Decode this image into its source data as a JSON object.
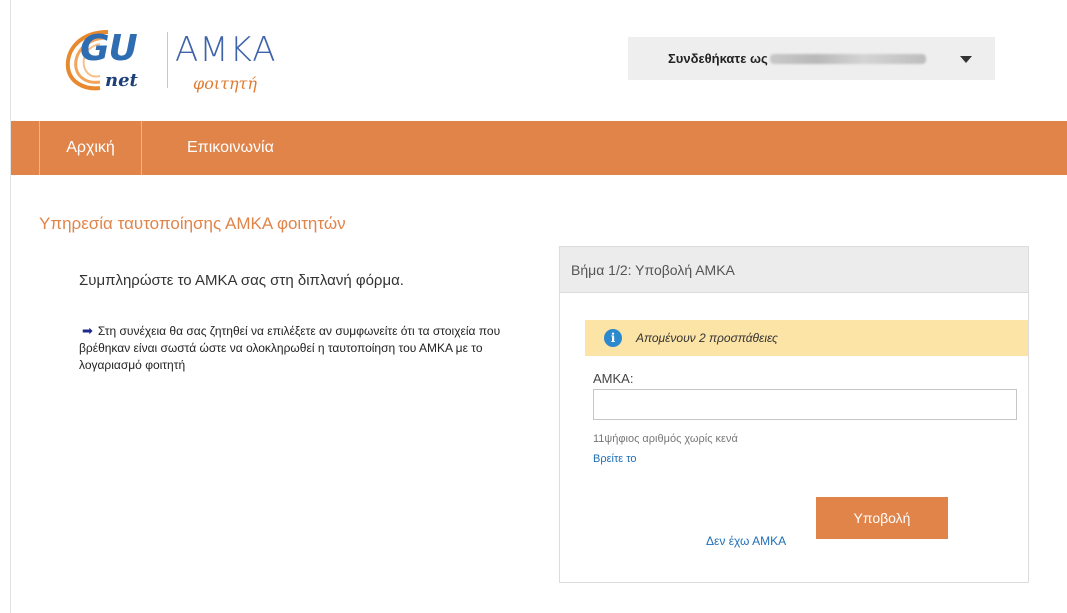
{
  "header": {
    "logo": {
      "gu_text": "GU",
      "net_text": "net",
      "amka_text": "AMKA",
      "subtitle": "φοιτητή"
    },
    "user_menu": {
      "label": "Συνδεθήκατε ως",
      "username_masked": true,
      "caret_icon": "caret-down-icon"
    }
  },
  "nav": {
    "tabs": [
      {
        "label": "Αρχική",
        "active": true
      },
      {
        "label": "Επικοινωνία",
        "active": false
      }
    ]
  },
  "main": {
    "page_title": "Υπηρεσία ταυτοποίησης ΑΜΚΑ φοιτητών",
    "intro": "Συμπληρώστε το ΑΜΚΑ σας στη διπλανή φόρμα.",
    "note": "Στη συνέχεια θα σας ζητηθεί να επιλέξετε αν συμφωνείτε ότι τα στοιχεία που βρέθηκαν είναι σωστά ώστε να ολοκληρωθεί η ταυτοποίηση του ΑΜΚΑ με το λογαριασμό φοιτητή",
    "note_icon": "arrow-right-icon"
  },
  "panel": {
    "title": "Βήμα 1/2: Υποβολή ΑΜΚΑ",
    "alert": {
      "icon": "info-icon",
      "message": "Απομένουν 2 προσπάθειες"
    },
    "field": {
      "label": "ΑΜΚΑ:",
      "value": "",
      "placeholder": ""
    },
    "hint": "11ψήφιος αριθμός χωρίς κενά",
    "find_link": "Βρείτε το",
    "no_amka_link": "Δεν έχω ΑΜΚΑ",
    "submit_label": "Υποβολή"
  },
  "colors": {
    "accent": "#e0844a",
    "alert_bg": "#fce3a6",
    "link": "#1e6fb8",
    "logo_blue": "#2f6db3"
  }
}
